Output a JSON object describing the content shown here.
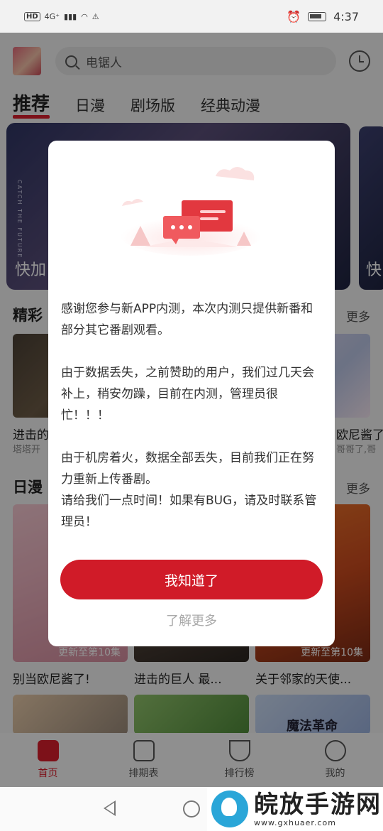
{
  "status_bar": {
    "hd": "HD",
    "network": "4G⁺",
    "time": "4:37"
  },
  "header": {
    "search_placeholder": "电锯人"
  },
  "tabs": [
    {
      "label": "推荐"
    },
    {
      "label": "日漫"
    },
    {
      "label": "剧场版"
    },
    {
      "label": "经典动漫"
    }
  ],
  "banner": {
    "caption": "快加",
    "vertical_text": "CATCH THE FUTURE",
    "next_caption": "快"
  },
  "section1": {
    "title": "精彩",
    "more": "更多",
    "left_title": "进击的",
    "left_sub": "塔塔开",
    "right_title": "欧尼酱了",
    "right_sub": "哥哥了,哥"
  },
  "section2": {
    "title": "日漫",
    "more": "更多",
    "cards": [
      {
        "caption": "更新至第10集",
        "title": "别当欧尼酱了!"
      },
      {
        "caption": "",
        "title": "进击的巨人 最..."
      },
      {
        "caption": "更新至第10集",
        "title": "关于邻家的天使..."
      }
    ],
    "bottom_card_text": "魔法革命"
  },
  "bottom_nav": [
    {
      "label": "首页",
      "icon": "home-icon"
    },
    {
      "label": "排期表",
      "icon": "calendar-icon"
    },
    {
      "label": "排行榜",
      "icon": "trophy-icon"
    },
    {
      "label": "我的",
      "icon": "smile-icon"
    }
  ],
  "watermark": {
    "name": "皖放手游网",
    "url": "www.gxhuaer.com"
  },
  "dialog": {
    "paragraph1": "感谢您参与新APP内测，本次内测只提供新番和部分其它番剧观看。",
    "paragraph2": "由于数据丢失，之前赞助的用户，我们过几天会补上，稍安勿躁，目前在内测，管理员很忙！！！",
    "paragraph3": "由于机房着火，数据全部丢失，目前我们正在努力重新上传番剧。",
    "paragraph4": "请给我们一点时间！如果有BUG，请及时联系管理员！",
    "confirm_label": "我知道了",
    "learn_more_label": "了解更多"
  },
  "colors": {
    "accent": "#d01b28"
  }
}
